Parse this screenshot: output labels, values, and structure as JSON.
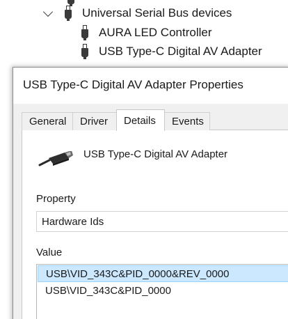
{
  "device_tree": {
    "category_label": "Universal Serial Bus devices",
    "items": [
      {
        "label": "AURA LED Controller",
        "icon": "usb-plug-icon"
      },
      {
        "label": "USB Type-C Digital AV Adapter",
        "icon": "usb-plug-icon"
      }
    ]
  },
  "dialog": {
    "title": "USB Type-C Digital AV Adapter Properties",
    "tabs": [
      {
        "label": "General"
      },
      {
        "label": "Driver"
      },
      {
        "label": "Details",
        "active": true
      },
      {
        "label": "Events"
      }
    ],
    "device_name": "USB Type-C Digital AV Adapter",
    "property_label": "Property",
    "property_value": "Hardware Ids",
    "value_label": "Value",
    "values": [
      {
        "text": "USB\\VID_343C&PID_0000&REV_0000",
        "selected": true
      },
      {
        "text": "USB\\VID_343C&PID_0000",
        "selected": false
      }
    ]
  },
  "colors": {
    "selection_background": "#cce8ff",
    "selection_border": "#99d1ff",
    "dialog_background": "#f0f0f0"
  }
}
